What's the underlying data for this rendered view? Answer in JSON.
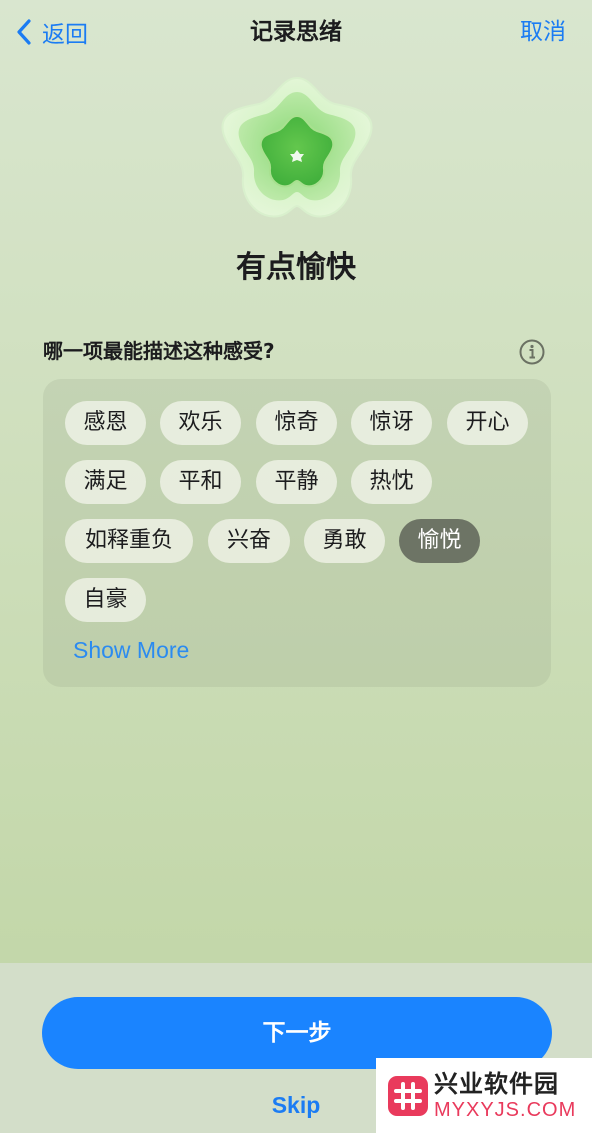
{
  "nav": {
    "back_label": "返回",
    "title": "记录思绪",
    "cancel_label": "取消"
  },
  "mood": {
    "title": "有点愉快"
  },
  "question": {
    "text": "哪一项最能描述这种感受?"
  },
  "feelings": {
    "chips": [
      {
        "label": "感恩",
        "selected": false
      },
      {
        "label": "欢乐",
        "selected": false
      },
      {
        "label": "惊奇",
        "selected": false
      },
      {
        "label": "惊讶",
        "selected": false
      },
      {
        "label": "开心",
        "selected": false
      },
      {
        "label": "满足",
        "selected": false
      },
      {
        "label": "平和",
        "selected": false
      },
      {
        "label": "平静",
        "selected": false
      },
      {
        "label": "热忱",
        "selected": false
      },
      {
        "label": "如释重负",
        "selected": false
      },
      {
        "label": "兴奋",
        "selected": false
      },
      {
        "label": "勇敢",
        "selected": false
      },
      {
        "label": "愉悦",
        "selected": true
      },
      {
        "label": "自豪",
        "selected": false
      }
    ],
    "show_more_label": "Show More"
  },
  "actions": {
    "next_label": "下一步",
    "skip_label": "Skip"
  },
  "watermark": {
    "name": "兴业软件园",
    "url": "MYXYJS.COM"
  },
  "colors": {
    "accent": "#1a84ff",
    "selected_chip": "#6d7465",
    "flower": "#6fcf5c"
  },
  "icons": {
    "back": "chevron-left-icon",
    "info": "info-circle-icon",
    "mood": "flower-icon"
  }
}
